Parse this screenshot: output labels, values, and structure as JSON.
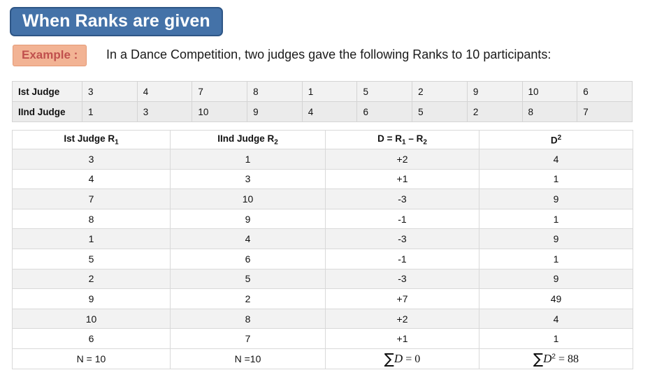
{
  "title": "When Ranks are given",
  "example": {
    "label": "Example :",
    "text": "In a Dance Competition, two judges gave the following Ranks to 10 participants:"
  },
  "ranks_table": {
    "rows": [
      {
        "header": "Ist Judge",
        "values": [
          "3",
          "4",
          "7",
          "8",
          "1",
          "5",
          "2",
          "9",
          "10",
          "6"
        ]
      },
      {
        "header": "IInd Judge",
        "values": [
          "1",
          "3",
          "10",
          "9",
          "4",
          "6",
          "5",
          "2",
          "8",
          "7"
        ]
      }
    ]
  },
  "calc_table": {
    "headers": [
      {
        "text": "Ist Judge R",
        "sub": "1"
      },
      {
        "text": "IInd Judge  R",
        "sub": "2"
      },
      {
        "text": "D = R",
        "sub": "1",
        "text2": " – R",
        "sub2": "2"
      },
      {
        "text": "D",
        "sup": "2"
      }
    ],
    "rows": [
      {
        "r1": "3",
        "r2": "1",
        "d": "+2",
        "d2": "4"
      },
      {
        "r1": "4",
        "r2": "3",
        "d": "+1",
        "d2": "1"
      },
      {
        "r1": "7",
        "r2": "10",
        "d": "-3",
        "d2": "9"
      },
      {
        "r1": "8",
        "r2": "9",
        "d": "-1",
        "d2": "1"
      },
      {
        "r1": "1",
        "r2": "4",
        "d": "-3",
        "d2": "9"
      },
      {
        "r1": "5",
        "r2": "6",
        "d": "-1",
        "d2": "1"
      },
      {
        "r1": "2",
        "r2": "5",
        "d": "-3",
        "d2": "9"
      },
      {
        "r1": "9",
        "r2": "2",
        "d": "+7",
        "d2": "49"
      },
      {
        "r1": "10",
        "r2": "8",
        "d": "+2",
        "d2": "4"
      },
      {
        "r1": "6",
        "r2": "7",
        "d": "+1",
        "d2": "1"
      }
    ],
    "totals": {
      "r1": "N = 10",
      "r2": "N =10",
      "d_sigma": "∑",
      "d_var": "D",
      "d_eq": " = 0",
      "d2_sigma": "∑",
      "d2_var": "D",
      "d2_sup": "2",
      "d2_eq": " = 88"
    }
  },
  "colors": {
    "title_bg": "#4472a8",
    "title_border": "#2e5686",
    "example_bg": "#f2b394",
    "example_text": "#c0504d"
  }
}
